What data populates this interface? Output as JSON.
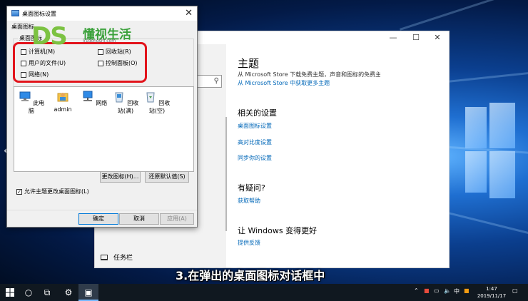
{
  "settings_window": {
    "page_title": "主题",
    "store_desc": "从 Microsoft Store 下载免费主题，声音和图标的免费主题",
    "store_link": "从 Microsoft Store 中获取更多主题",
    "related_title": "相关的设置",
    "related_links": [
      "桌面图标设置",
      "高对比度设置",
      "同步你的设置"
    ],
    "question_title": "有疑问?",
    "help_link": "获取帮助",
    "improve_title": "让 Windows 变得更好",
    "feedback_link": "提供反馈",
    "taskbar_label": "任务栏",
    "controls": {
      "minimize": "—",
      "maximize": "☐",
      "close": "✕"
    }
  },
  "dialog": {
    "title": "桌面图标设置",
    "tab": "桌面图标",
    "group_label": "桌面图标",
    "checkboxes": [
      {
        "label": "计算机(M)",
        "checked": false
      },
      {
        "label": "回收站(R)",
        "checked": false
      },
      {
        "label": "用户的文件(U)",
        "checked": false
      },
      {
        "label": "控制面板(O)",
        "checked": false
      },
      {
        "label": "网络(N)",
        "checked": false
      }
    ],
    "icons": [
      "此电脑",
      "admin",
      "网络",
      "回收站(满)",
      "回收站(空)"
    ],
    "change_icon_button": "更改图标(H)...",
    "restore_default_button": "还原默认值(S)",
    "allow_themes_label": "允许主题更改桌面图标(L)",
    "allow_themes_checked": true,
    "ok_button": "确定",
    "cancel_button": "取消",
    "apply_button": "应用(A)"
  },
  "watermark": {
    "logo": "DS",
    "text": "懂视生活",
    "url": "51dongshi.com"
  },
  "subtitle": "3.在弹出的桌面图标对话框中",
  "taskbar": {
    "ime": "中",
    "time": "1:47",
    "date": "2019/11/17"
  },
  "colors": {
    "accent": "#0067b8",
    "highlight_box": "#e2141c",
    "watermark_green": "#7cc242"
  }
}
